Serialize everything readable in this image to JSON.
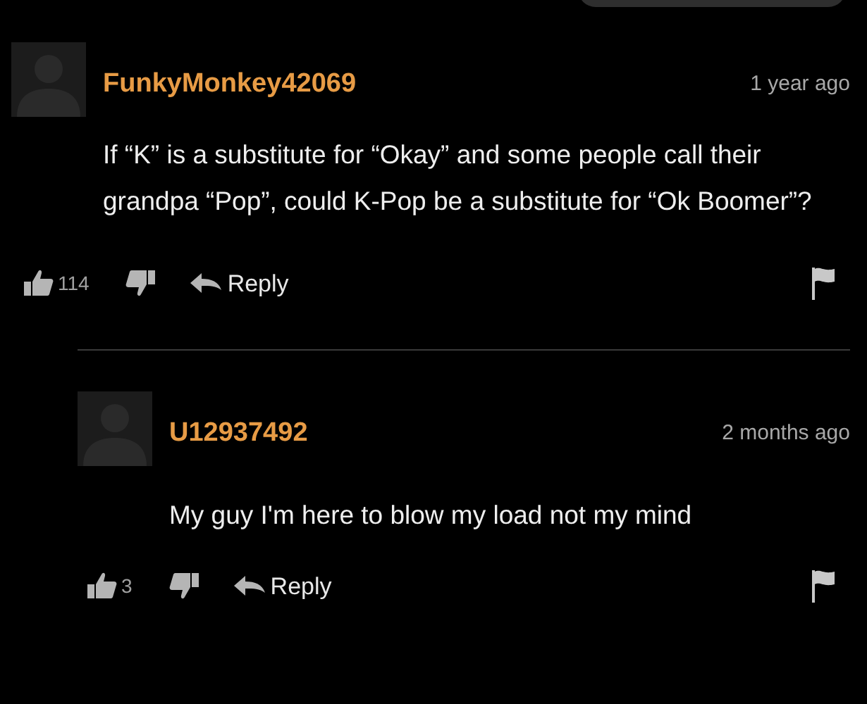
{
  "comments": [
    {
      "username": "FunkyMonkey42069",
      "time": "1 year ago",
      "text": "If “K” is a substitute for “Okay” and some people call their grandpa “Pop”, could K-Pop be a substitute for “Ok Boomer”?",
      "likes": "114",
      "reply_label": "Reply",
      "children": [
        {
          "username": "U12937492",
          "time": "2 months ago",
          "text": "My guy I'm here to blow my load not my mind",
          "likes": "3",
          "reply_label": "Reply"
        }
      ]
    }
  ]
}
